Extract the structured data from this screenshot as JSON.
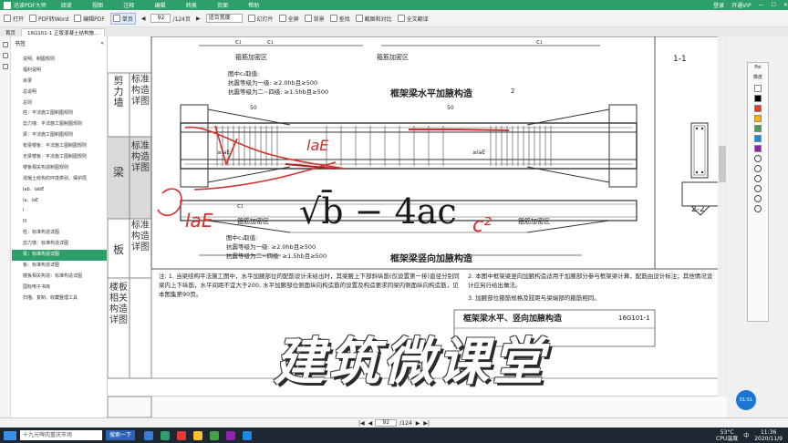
{
  "app": {
    "title": "迅读PDF大师",
    "menu": [
      "阅读",
      "视图",
      "注释",
      "编辑",
      "转换",
      "页面",
      "帮助"
    ],
    "right": [
      "登录",
      "开通VIP"
    ]
  },
  "toolbar": {
    "open": "打开",
    "pdf_to_word": "PDF转Word",
    "edit_pdf": "编辑PDF",
    "single_page": "单页",
    "page_current": "92",
    "page_total": "/124页",
    "zoom": "适合宽度",
    "slideshow": "幻灯片",
    "fullscreen": "全屏",
    "background": "背景",
    "find": "查找",
    "compare": "截图和对比",
    "translate": "全文翻译"
  },
  "tabs": {
    "home": "首页",
    "doc": "16G101-1 正版混凝土结构施..."
  },
  "sidebar": {
    "header": "书签",
    "items": [
      "说明、制图规则",
      "福利说明",
      "目录",
      "总说明",
      "总则",
      "柱：平法施工图制图规则",
      "剪力墙：平法施工图制图规则",
      "梁：平法施工图制图规则",
      "有梁楼板：平法施工图制图规则",
      "无梁楼板：平法施工图制图规则",
      "楼板相关构造制图规则",
      "混凝土结构的环境类别、保护层",
      "lab、labE",
      "la、laE",
      "l",
      "lll",
      "柱：标准构造详图",
      "剪力墙：标准构造详图",
      "梁：标准构造详图",
      "板：标准构造详图",
      "楼板相关构造：标准构造详图",
      "国标电子书库",
      "扫描、复制、收藏整理工具"
    ],
    "selected_index": 18
  },
  "document": {
    "left_labels": {
      "shear_wall": "剪力墙",
      "std": "标准构造详图",
      "beam": "梁",
      "slab": "板",
      "slab_rel": "楼板相关构造详图"
    },
    "top": {
      "c1": "c₁",
      "dense_zone": "箍筋加密区",
      "section_1": "1-1",
      "section_2": "2-2",
      "haunch_h_title": "框架梁水平加腋构造",
      "haunch_v_title": "框架梁竖向加腋构造",
      "c_take": "图中c₃取值:",
      "grade1": "抗震等级为一级: ≥2.0hb且≥500",
      "grade2": "抗震等级为二~四级: ≥1.5hb且≥500",
      "dim_50": "50",
      "lae": "≥laE",
      "num_2": "2",
      "num_1": "1"
    },
    "notes": {
      "n1": "注: 1. 当梁结构平法施工图中，水平加腋部位的配筋设计未给出时，其梁腋上下部斜纵筋(仅设置第一排)直径分别同梁内上下纵筋，水平间距不宜大于200; 水平加腋部位侧面纵向构造筋的设置及构造要求同梁内侧面纵向构造筋，见本图集第90页。",
      "n2": "2. 本图中框架梁竖向加腋构造适用于加腋部分参与框架梁计算，配筋由设计标注；其他情况设计应另行给出做法。",
      "n3": "3. 加腋部位箍筋规格及肢距与梁端部的箍筋相同。",
      "fig_no": "16G101-1",
      "title_block": "框架梁水平、竖向加腋构造"
    },
    "handwriting": {
      "a": "laE",
      "b": "laE",
      "c": "√b̄ − 4ac",
      "d": "c²"
    }
  },
  "statusbar": {
    "page": "92",
    "total": "/124"
  },
  "watermark": "建筑微课堂",
  "rightpanel": {
    "pen_header": "Poi",
    "pen_sub": "橡皮",
    "badge": "01:51",
    "colors": [
      "#ffffff",
      "#000000",
      "#e53935",
      "#ffb300",
      "#43a047",
      "#1e88e5",
      "#8e24aa"
    ]
  },
  "taskbar": {
    "search": "十九元啤肉重庆市场",
    "search_btn": "搜索一下",
    "temp": "53°C",
    "cpu": "CPU温度",
    "lang": "中",
    "time": "11:36",
    "date": "2020/11/9"
  }
}
